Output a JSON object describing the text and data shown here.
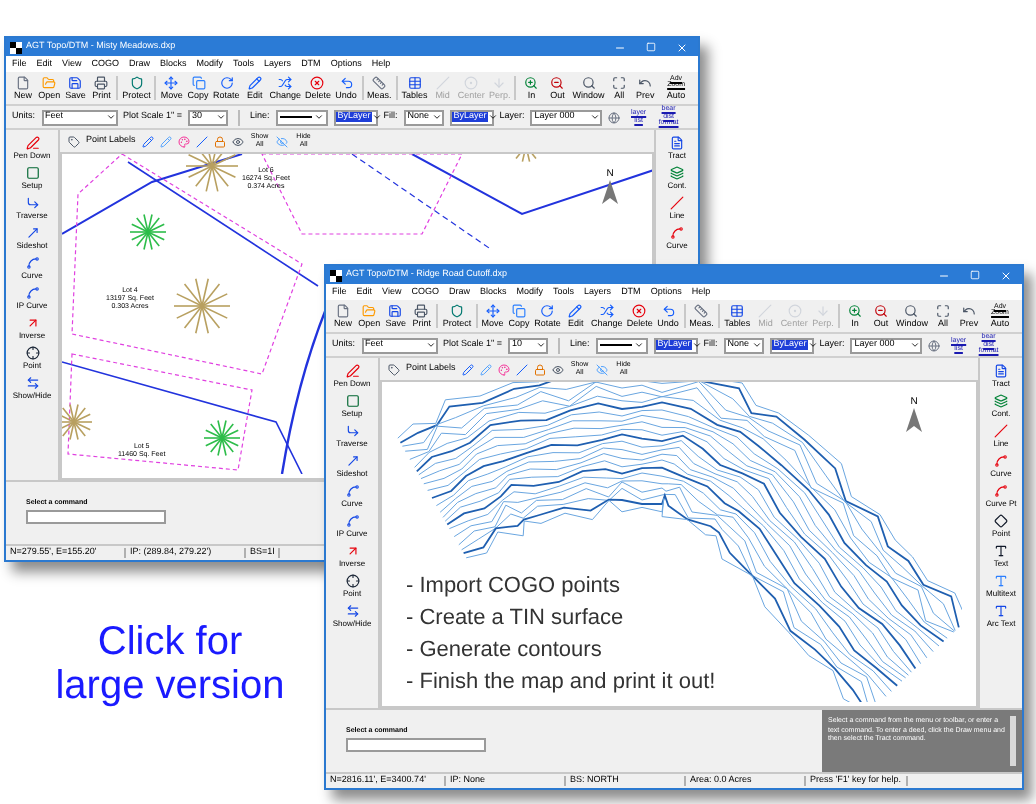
{
  "windows": [
    {
      "title": "AGT Topo/DTM - Misty Meadows.dxp",
      "menu": [
        "File",
        "Edit",
        "View",
        "COGO",
        "Draw",
        "Blocks",
        "Modify",
        "Tools",
        "Layers",
        "DTM",
        "Options",
        "Help"
      ],
      "toolbar": [
        {
          "label": "New",
          "disabled": false
        },
        {
          "label": "Open",
          "disabled": false
        },
        {
          "label": "Save",
          "disabled": false
        },
        {
          "label": "Print",
          "disabled": false
        },
        {
          "label": "Protect",
          "disabled": false
        },
        {
          "label": "Move",
          "disabled": false
        },
        {
          "label": "Copy",
          "disabled": false
        },
        {
          "label": "Rotate",
          "disabled": false
        },
        {
          "label": "Edit",
          "disabled": false
        },
        {
          "label": "Change",
          "disabled": false
        },
        {
          "label": "Delete",
          "disabled": false
        },
        {
          "label": "Undo",
          "disabled": false
        },
        {
          "label": "Meas.",
          "disabled": false
        },
        {
          "label": "Tables",
          "disabled": false
        },
        {
          "label": "Mid",
          "disabled": true
        },
        {
          "label": "Center",
          "disabled": true
        },
        {
          "label": "Perp.",
          "disabled": true
        },
        {
          "label": "In",
          "disabled": false
        },
        {
          "label": "Out",
          "disabled": false
        },
        {
          "label": "Window",
          "disabled": false
        },
        {
          "label": "All",
          "disabled": false
        },
        {
          "label": "Prev",
          "disabled": false
        },
        {
          "label": "Auto",
          "icon_text": "Adv Zoom",
          "disabled": false
        }
      ],
      "options": {
        "units_label": "Units:",
        "units": "Feet",
        "plot_scale_label": "Plot Scale 1\" =",
        "plot_scale": "30",
        "line_label": "Line:",
        "line_color": "ByLayer",
        "fill_label": "Fill:",
        "fill": "None",
        "fill_color": "ByLayer",
        "layer_label": "Layer:",
        "layer": "Layer 000",
        "links": [
          "layer list",
          "bear dist format"
        ]
      },
      "labels_bar": {
        "point_labels": "Point Labels",
        "show_all": "Show All",
        "hide_all": "Hide All"
      },
      "left_tools": [
        "Pen Down",
        "Setup",
        "Traverse",
        "Sideshot",
        "Curve",
        "IP Curve",
        "Inverse",
        "Point",
        "Show/Hide"
      ],
      "right_tools": [
        "Tract",
        "Cont.",
        "Line",
        "Curve"
      ],
      "canvas": {
        "kind": "lot-plan",
        "north": "N",
        "lots": [
          {
            "name": "Lot 6",
            "lines": [
              "16274 Sq. Feet",
              "0.374 Acres"
            ]
          },
          {
            "name": "Lot 4",
            "lines": [
              "13197 Sq. Feet",
              "0.303 Acres"
            ]
          },
          {
            "name": "Lot 5",
            "lines": [
              "11460 Sq. Feet"
            ]
          }
        ]
      },
      "prompt": "Select a command",
      "status": [
        "N=279.55', E=155.20'",
        "IP: (289.84, 279.22')",
        "BS=1I"
      ]
    },
    {
      "title": "AGT Topo/DTM - Ridge Road Cutoff.dxp",
      "menu": [
        "File",
        "Edit",
        "View",
        "COGO",
        "Draw",
        "Blocks",
        "Modify",
        "Tools",
        "Layers",
        "DTM",
        "Options",
        "Help"
      ],
      "toolbar": [
        {
          "label": "New",
          "disabled": false
        },
        {
          "label": "Open",
          "disabled": false
        },
        {
          "label": "Save",
          "disabled": false
        },
        {
          "label": "Print",
          "disabled": false
        },
        {
          "label": "Protect",
          "disabled": false
        },
        {
          "label": "Move",
          "disabled": false
        },
        {
          "label": "Copy",
          "disabled": false
        },
        {
          "label": "Rotate",
          "disabled": false
        },
        {
          "label": "Edit",
          "disabled": false
        },
        {
          "label": "Change",
          "disabled": false
        },
        {
          "label": "Delete",
          "disabled": false
        },
        {
          "label": "Undo",
          "disabled": false
        },
        {
          "label": "Meas.",
          "disabled": false
        },
        {
          "label": "Tables",
          "disabled": false
        },
        {
          "label": "Mid",
          "disabled": true
        },
        {
          "label": "Center",
          "disabled": true
        },
        {
          "label": "Perp.",
          "disabled": true
        },
        {
          "label": "In",
          "disabled": false
        },
        {
          "label": "Out",
          "disabled": false
        },
        {
          "label": "Window",
          "disabled": false
        },
        {
          "label": "All",
          "disabled": false
        },
        {
          "label": "Prev",
          "disabled": false
        },
        {
          "label": "Auto",
          "icon_text": "Adv Zoom",
          "disabled": false
        }
      ],
      "options": {
        "units_label": "Units:",
        "units": "Feet",
        "plot_scale_label": "Plot Scale 1\" =",
        "plot_scale": "10",
        "line_label": "Line:",
        "line_color": "ByLayer",
        "fill_label": "Fill:",
        "fill": "None",
        "fill_color": "ByLayer",
        "layer_label": "Layer:",
        "layer": "Layer 000",
        "links": [
          "layer list",
          "bear dist format"
        ]
      },
      "labels_bar": {
        "point_labels": "Point Labels",
        "show_all": "Show All",
        "hide_all": "Hide All"
      },
      "left_tools": [
        "Pen Down",
        "Setup",
        "Traverse",
        "Sideshot",
        "Curve",
        "IP Curve",
        "Inverse",
        "Point",
        "Show/Hide"
      ],
      "right_tools": [
        "Tract",
        "Cont.",
        "Line",
        "Curve",
        "Curve Pt",
        "Point",
        "Text",
        "Multitext",
        "Arc Text"
      ],
      "canvas": {
        "kind": "contours",
        "north": "N",
        "overlay_lines": [
          "- Import COGO points",
          "- Create a TIN surface",
          "- Generate contours",
          "- Finish the map and print it out!"
        ]
      },
      "prompt": "Select a command",
      "help": "Select a command from the menu or toolbar, or enter a text command. To enter a deed, click the Draw menu and then select the Tract command.",
      "status": [
        "N=2816.11', E=3400.74'",
        "IP: None",
        "BS: NORTH",
        "Area: 0.0 Acres",
        "Press 'F1' key for help."
      ]
    }
  ],
  "promo": [
    "Click for",
    "large version"
  ]
}
